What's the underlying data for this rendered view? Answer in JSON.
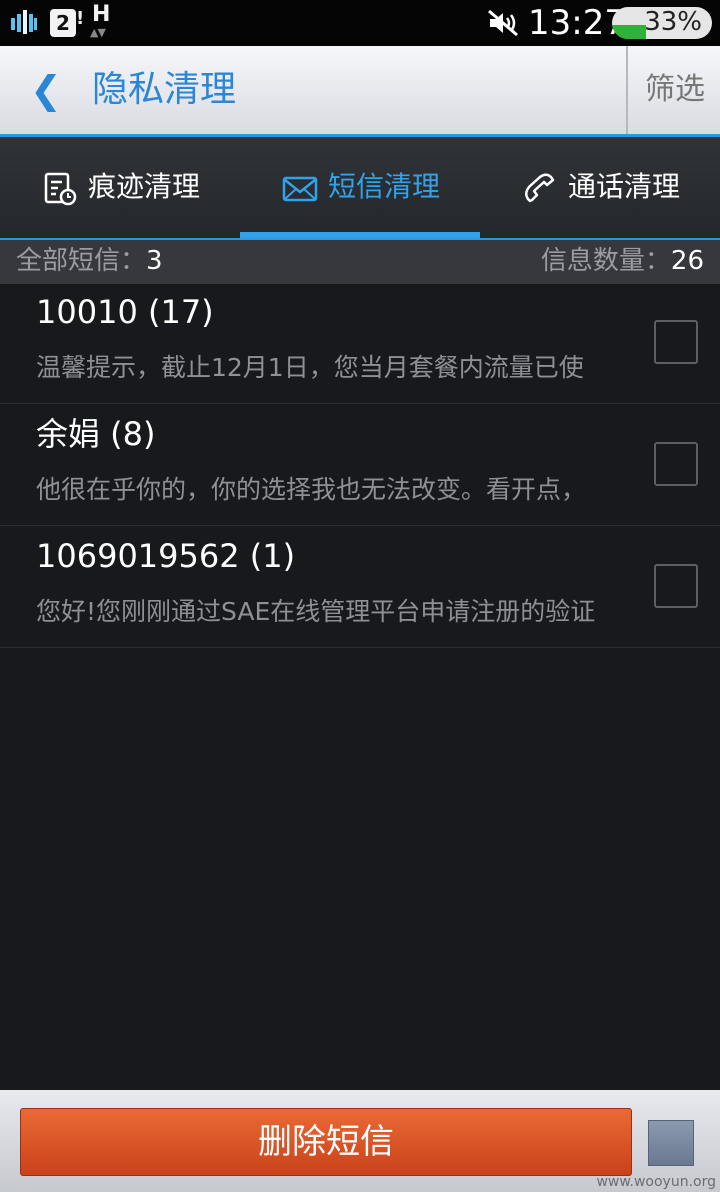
{
  "status_bar": {
    "sim_slot": "2",
    "sim_mark": "!",
    "network": "H",
    "time": "13:27",
    "battery": "33%"
  },
  "header": {
    "title": "隐私清理",
    "filter_label": "筛选"
  },
  "tabs": [
    {
      "label": "痕迹清理",
      "icon": "history-clean-icon",
      "active": false
    },
    {
      "label": "短信清理",
      "icon": "mail-icon",
      "active": true
    },
    {
      "label": "通话清理",
      "icon": "phone-icon",
      "active": false
    }
  ],
  "summary": {
    "total_label": "全部短信：",
    "total_value": "3",
    "count_label": "信息数量：",
    "count_value": "26"
  },
  "messages": [
    {
      "name": "10010 (17)",
      "preview": "温馨提示，截止12月1日，您当月套餐内流量已使"
    },
    {
      "name": "余娟 (8)",
      "preview": "他很在乎你的，你的选择我也无法改变。看开点，"
    },
    {
      "name": "1069019562 (1)",
      "preview": "您好!您刚刚通过SAE在线管理平台申请注册的验证"
    }
  ],
  "footer": {
    "delete_label": "删除短信"
  },
  "watermark": "www.wooyun.org",
  "colors": {
    "accent": "#2e95dc",
    "delete_button": "#d9531f"
  }
}
